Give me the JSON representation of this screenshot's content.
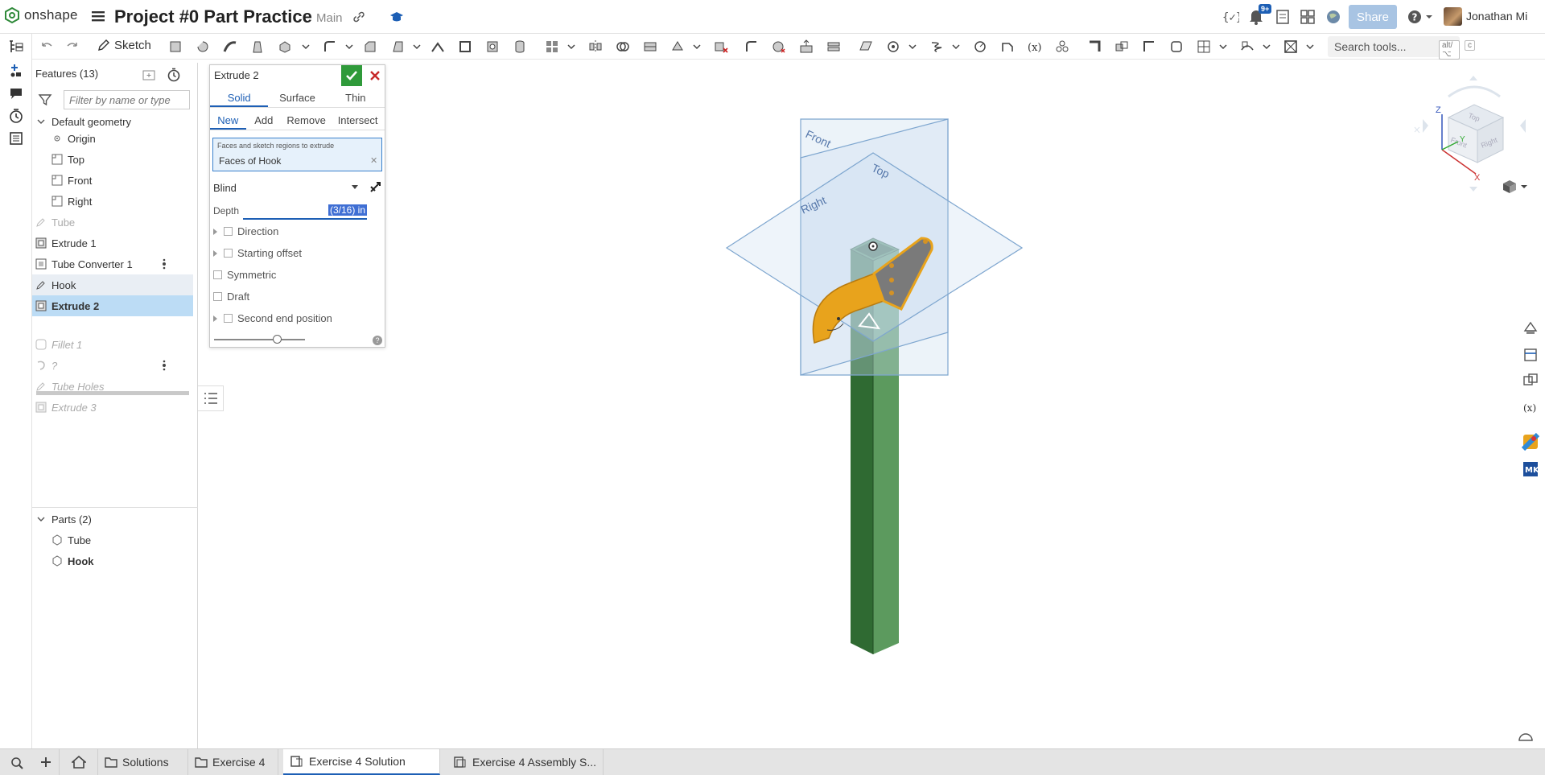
{
  "header": {
    "logo_text": "onshape",
    "title": "Project #0 Part Practice",
    "branch": "Main",
    "share_label": "Share",
    "notifications_badge": "9+",
    "username": "Jonathan Mi"
  },
  "toolbar": {
    "sketch_label": "Sketch",
    "search_label": "Search tools...",
    "search_shortcut_1": "alt/⌥",
    "search_shortcut_2": "c"
  },
  "features": {
    "header": "Features (13)",
    "filter_placeholder": "Filter by name or type",
    "default_geometry": "Default geometry",
    "origin": "Origin",
    "planes": [
      "Top",
      "Front",
      "Right"
    ],
    "items": [
      {
        "label": "Tube",
        "state": "sketch-hidden"
      },
      {
        "label": "Extrude 1",
        "state": "normal"
      },
      {
        "label": "Tube Converter 1",
        "state": "normal"
      },
      {
        "label": "Hook",
        "state": "hovered"
      },
      {
        "label": "Extrude 2",
        "state": "selected"
      }
    ],
    "rolled_back": [
      "Fillet 1",
      "?",
      "Tube Holes",
      "Extrude 3"
    ]
  },
  "parts": {
    "header": "Parts (2)",
    "items": [
      "Tube",
      "Hook"
    ]
  },
  "dialog": {
    "title": "Extrude 2",
    "body_types": [
      "Solid",
      "Surface",
      "Thin"
    ],
    "operations": [
      "New",
      "Add",
      "Remove",
      "Intersect"
    ],
    "faces_hint": "Faces and sketch regions to extrude",
    "faces_value": "Faces of Hook",
    "end_type": "Blind",
    "depth_label": "Depth",
    "depth_value": "(3/16) in",
    "options": [
      "Direction",
      "Starting offset",
      "Symmetric",
      "Draft",
      "Second end position"
    ]
  },
  "viewcube": {
    "faces": [
      "Top",
      "Front",
      "Right"
    ],
    "axes": [
      "Z",
      "Y",
      "X"
    ]
  },
  "viewport": {
    "plane_labels": [
      "Front",
      "Top",
      "Right"
    ],
    "tube_color": "#3e8a45",
    "hook_color": "#e8a31c"
  },
  "bottom_tabs": [
    "Solutions",
    "Exercise 4",
    "Exercise 4 Solution",
    "Exercise 4 Assembly S..."
  ]
}
